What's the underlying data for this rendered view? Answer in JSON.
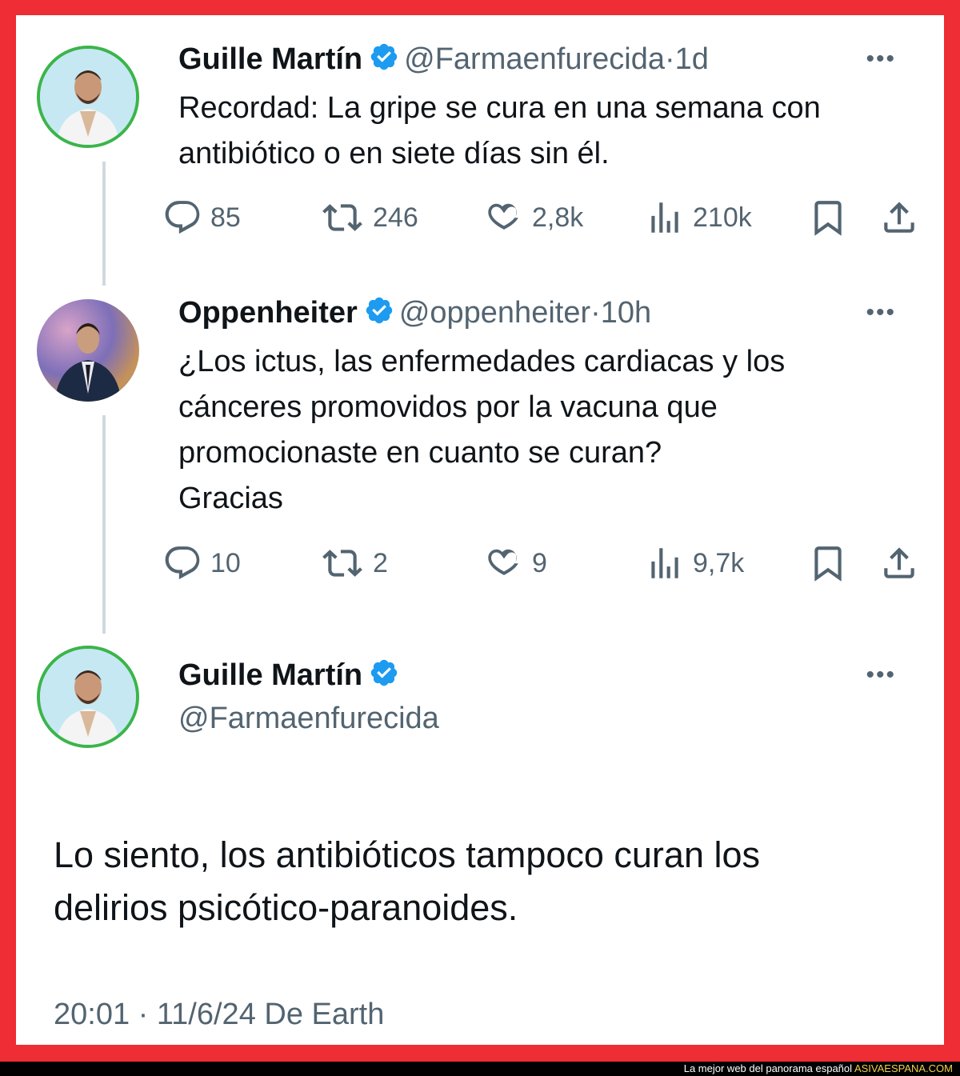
{
  "tweets": [
    {
      "name": "Guille Martín",
      "handle": "@Farmaenfurecida",
      "sep": "·",
      "time": "1d",
      "text_lines": [
        "Recordad: La gripe se cura en una semana con",
        "antibiótico o en siete días sin él."
      ],
      "replies": "85",
      "retweets": "246",
      "likes": "2,8k",
      "views": "210k"
    },
    {
      "name": "Oppenheiter",
      "handle": "@oppenheiter",
      "sep": "·",
      "time": "10h",
      "text_lines": [
        "¿Los ictus, las enfermedades cardiacas y los",
        "cánceres promovidos por la vacuna que",
        "promocionaste en cuanto se curan?",
        "Gracias"
      ],
      "replies": "10",
      "retweets": "2",
      "likes": "9",
      "views": "9,7k"
    }
  ],
  "main_tweet": {
    "name": "Guille Martín",
    "handle": "@Farmaenfurecida",
    "text_lines": [
      "Lo siento, los antibióticos tampoco curan los",
      "delirios psicótico-paranoides."
    ],
    "meta": "20:01 · 11/6/24 De Earth"
  },
  "more_label": "•••",
  "footer": {
    "text": "La mejor web del panorama español ",
    "site": "ASIVAESPANA.COM"
  },
  "colors": {
    "frame": "#ee2d34",
    "verified": "#1d9bf0",
    "muted": "#536471",
    "avatar_ring": "#3bb54a"
  },
  "icons": [
    "reply-icon",
    "retweet-icon",
    "like-icon",
    "views-icon",
    "bookmark-icon",
    "share-icon",
    "verified-icon",
    "more-icon"
  ]
}
